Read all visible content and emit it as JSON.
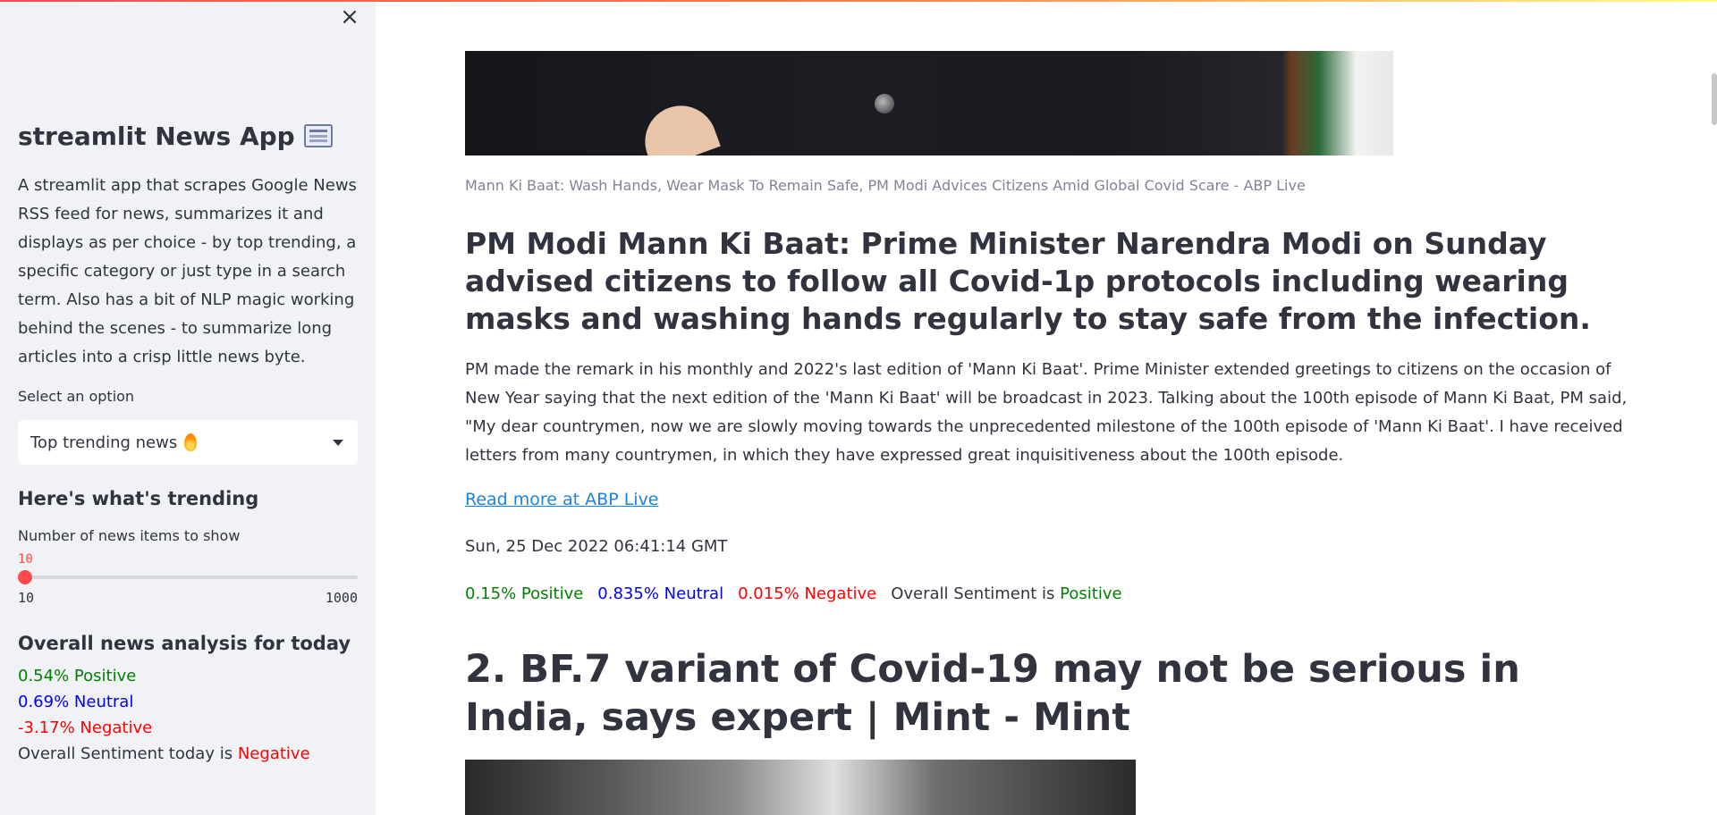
{
  "sidebar": {
    "title": "streamlit News App",
    "description": "A streamlit app that scrapes Google News RSS feed for news, summarizes it and displays as per choice - by top trending, a specific category or just type in a search term. Also has a bit of NLP magic working behind the scenes - to summarize long articles into a crisp little news byte.",
    "select_label": "Select an option",
    "select_value": "Top trending news",
    "trending_heading": "Here's what's trending",
    "slider_label": "Number of news items to show",
    "slider_value": "10",
    "slider_min": "10",
    "slider_max": "1000",
    "analysis_heading": "Overall news analysis for today",
    "positive": "0.54% Positive",
    "neutral": "0.69% Neutral",
    "negative": "-3.17% Negative",
    "overall_prefix": "Overall Sentiment today is",
    "overall_value": "Negative"
  },
  "article1": {
    "caption": "Mann Ki Baat: Wash Hands, Wear Mask To Remain Safe, PM Modi Advices Citizens Amid Global Covid Scare - ABP Live",
    "heading": "PM Modi Mann Ki Baat: Prime Minister Narendra Modi on Sunday advised citizens to follow all Covid-1p protocols including wearing masks and washing hands regularly to stay safe from the infection.",
    "body": "PM made the remark in his monthly and 2022's last edition of 'Mann Ki Baat'. Prime Minister extended greetings to citizens on the occasion of New Year saying that the next edition of the 'Mann Ki Baat' will be broadcast in 2023. Talking about the 100th episode of Mann Ki Baat, PM said, \"My dear countrymen, now we are slowly moving towards the unprecedented milestone of the 100th episode of 'Mann Ki Baat'. I have received letters from many countrymen, in which they have expressed great inquisitiveness about the 100th episode.",
    "read_more": "Read more at ABP Live",
    "date": "Sun, 25 Dec 2022 06:41:14 GMT",
    "positive": "0.15% Positive",
    "neutral": "0.835% Neutral",
    "negative": "0.015% Negative",
    "overall_prefix": "Overall Sentiment is",
    "overall_value": "Positive"
  },
  "article2": {
    "heading": "2. BF.7 variant of Covid-19 may not be serious in India, says expert | Mint - Mint"
  },
  "icons": {
    "close": "close-icon",
    "title_emoji": "newspaper-icon",
    "option_emoji": "fire-icon",
    "dropdown": "chevron-down-icon"
  },
  "colors": {
    "positive": "#008000",
    "neutral": "#0000ff",
    "negative": "#ff0000",
    "accent": "#ff4b4b",
    "link": "#1c83e1"
  }
}
